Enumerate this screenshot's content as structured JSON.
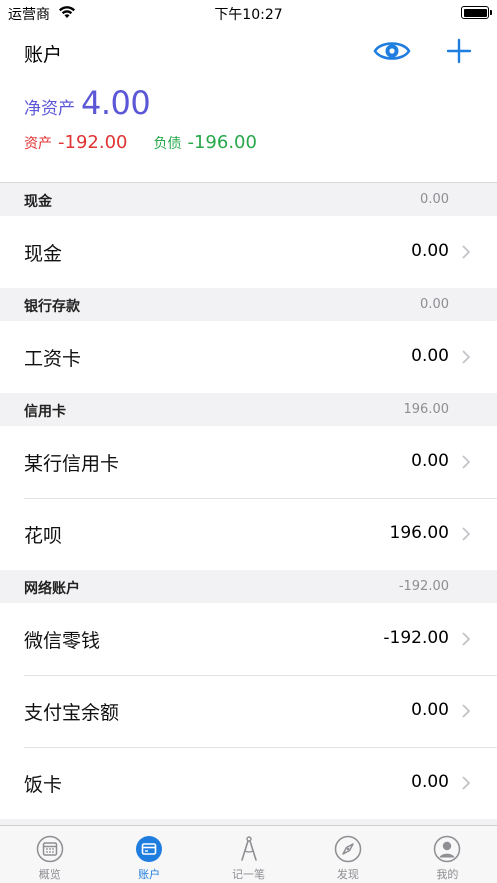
{
  "status": {
    "carrier": "运营商",
    "time": "下午10:27",
    "battery_level": 1.0
  },
  "header": {
    "title": "账户",
    "net_label": "净资产",
    "net_value": "4.00",
    "asset_label": "资产",
    "asset_value": "-192.00",
    "debt_label": "负债",
    "debt_value": "-196.00",
    "eye_icon": "eye-icon",
    "add_icon": "plus-icon"
  },
  "sections": [
    {
      "title": "现金",
      "total": "0.00",
      "rows": [
        {
          "name": "现金",
          "value": "0.00"
        }
      ]
    },
    {
      "title": "银行存款",
      "total": "0.00",
      "rows": [
        {
          "name": "工资卡",
          "value": "0.00"
        }
      ]
    },
    {
      "title": "信用卡",
      "total": "196.00",
      "rows": [
        {
          "name": "某行信用卡",
          "value": "0.00"
        },
        {
          "name": "花呗",
          "value": "196.00"
        }
      ]
    },
    {
      "title": "网络账户",
      "total": "-192.00",
      "rows": [
        {
          "name": "微信零钱",
          "value": "-192.00"
        },
        {
          "name": "支付宝余额",
          "value": "0.00"
        },
        {
          "name": "饭卡",
          "value": "0.00"
        }
      ]
    }
  ],
  "tabs": [
    {
      "label": "概览",
      "icon": "calendar-icon",
      "active": false
    },
    {
      "label": "账户",
      "icon": "card-icon",
      "active": true
    },
    {
      "label": "记一笔",
      "icon": "compass-draw-icon",
      "active": false
    },
    {
      "label": "发现",
      "icon": "compass-icon",
      "active": false
    },
    {
      "label": "我的",
      "icon": "user-icon",
      "active": false
    }
  ],
  "colors": {
    "accent": "#1f7de0",
    "net": "#5b57d6",
    "asset": "#e03434",
    "debt": "#27a84a"
  }
}
